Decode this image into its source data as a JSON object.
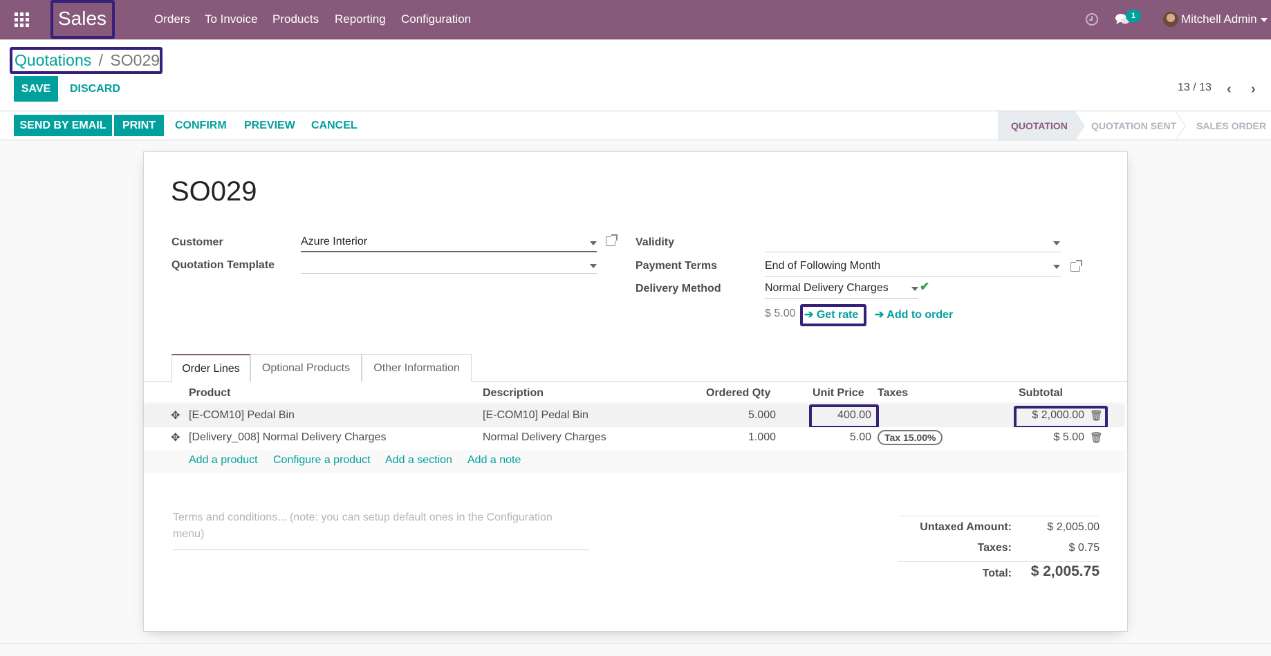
{
  "navbar": {
    "app_name": "Sales",
    "menu": [
      "Orders",
      "To Invoice",
      "Products",
      "Reporting",
      "Configuration"
    ],
    "messages_badge": "1",
    "user_name": "Mitchell Admin",
    "icons": {
      "apps": "grid-icon",
      "activity": "clock-icon",
      "messages": "chat-icon",
      "user_menu": "caret-down-icon"
    }
  },
  "breadcrumb": {
    "parent": "Quotations",
    "separator": "/",
    "current": "SO029"
  },
  "control": {
    "save_label": "SAVE",
    "discard_label": "DISCARD",
    "pager": "13 / 13"
  },
  "statusbar": {
    "buttons": [
      "SEND BY EMAIL",
      "PRINT",
      "CONFIRM",
      "PREVIEW",
      "CANCEL"
    ],
    "stages": [
      "QUOTATION",
      "QUOTATION SENT",
      "SALES ORDER"
    ],
    "active_stage": "QUOTATION"
  },
  "form": {
    "title": "SO029",
    "customer_label": "Customer",
    "customer_value": "Azure Interior",
    "template_label": "Quotation Template",
    "template_value": "",
    "validity_label": "Validity",
    "validity_value": "",
    "payment_terms_label": "Payment Terms",
    "payment_terms_value": "End of Following Month",
    "delivery_label": "Delivery Method",
    "delivery_value": "Normal Delivery Charges",
    "delivery_price": "$ 5.00",
    "get_rate_label": "Get rate",
    "add_to_order_label": "Add to order"
  },
  "tabs": [
    "Order Lines",
    "Optional Products",
    "Other Information"
  ],
  "active_tab": "Order Lines",
  "order_lines": {
    "columns": [
      "Product",
      "Description",
      "Ordered Qty",
      "Unit Price",
      "Taxes",
      "Subtotal"
    ],
    "rows": [
      {
        "product": "[E-COM10] Pedal Bin",
        "description": "[E-COM10] Pedal Bin",
        "qty": "5.000",
        "unit_price": "400.00",
        "taxes": "",
        "subtotal": "$ 2,000.00"
      },
      {
        "product": "[Delivery_008] Normal Delivery Charges",
        "description": "Normal Delivery Charges",
        "qty": "1.000",
        "unit_price": "5.00",
        "taxes": "Tax 15.00%",
        "subtotal": "$ 5.00"
      }
    ],
    "add_links": [
      "Add a product",
      "Configure a product",
      "Add a section",
      "Add a note"
    ]
  },
  "terms_placeholder_line1": "Terms and conditions... (note: you can setup default ones in the Configuration",
  "terms_placeholder_line2": "menu)",
  "totals": {
    "untaxed_label": "Untaxed Amount:",
    "untaxed_value": "$ 2,005.00",
    "taxes_label": "Taxes:",
    "taxes_value": "$ 0.75",
    "total_label": "Total:",
    "total_value": "$ 2,005.75"
  },
  "colors": {
    "brand": "#875a7b",
    "accent": "#00a09d",
    "highlight": "#37207a"
  }
}
